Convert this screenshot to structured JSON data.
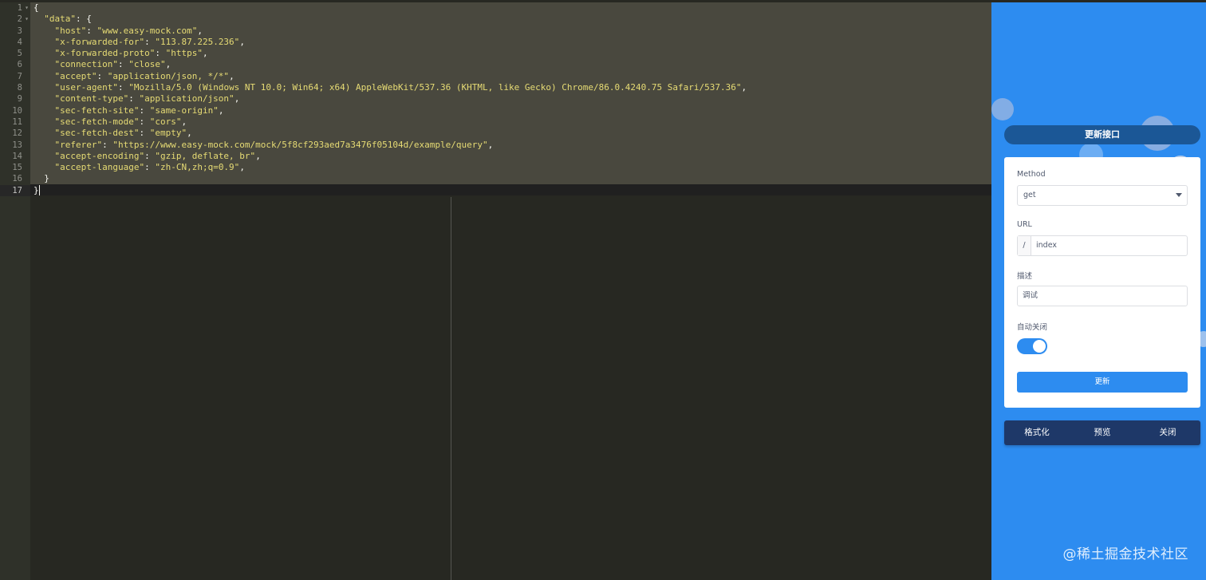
{
  "editor": {
    "line_numbers": [
      "1",
      "2",
      "3",
      "4",
      "5",
      "6",
      "7",
      "8",
      "9",
      "10",
      "11",
      "12",
      "13",
      "14",
      "15",
      "16",
      "17"
    ],
    "lines": [
      [
        {
          "t": "p",
          "v": "{"
        }
      ],
      [
        {
          "t": "p",
          "v": "  "
        },
        {
          "t": "key",
          "v": "\"data\""
        },
        {
          "t": "p",
          "v": ": {"
        }
      ],
      [
        {
          "t": "p",
          "v": "    "
        },
        {
          "t": "key",
          "v": "\"host\""
        },
        {
          "t": "p",
          "v": ": "
        },
        {
          "t": "str",
          "v": "\"www.easy-mock.com\""
        },
        {
          "t": "p",
          "v": ","
        }
      ],
      [
        {
          "t": "p",
          "v": "    "
        },
        {
          "t": "key",
          "v": "\"x-forwarded-for\""
        },
        {
          "t": "p",
          "v": ": "
        },
        {
          "t": "str",
          "v": "\"113.87.225.236\""
        },
        {
          "t": "p",
          "v": ","
        }
      ],
      [
        {
          "t": "p",
          "v": "    "
        },
        {
          "t": "key",
          "v": "\"x-forwarded-proto\""
        },
        {
          "t": "p",
          "v": ": "
        },
        {
          "t": "str",
          "v": "\"https\""
        },
        {
          "t": "p",
          "v": ","
        }
      ],
      [
        {
          "t": "p",
          "v": "    "
        },
        {
          "t": "key",
          "v": "\"connection\""
        },
        {
          "t": "p",
          "v": ": "
        },
        {
          "t": "str",
          "v": "\"close\""
        },
        {
          "t": "p",
          "v": ","
        }
      ],
      [
        {
          "t": "p",
          "v": "    "
        },
        {
          "t": "key",
          "v": "\"accept\""
        },
        {
          "t": "p",
          "v": ": "
        },
        {
          "t": "str",
          "v": "\"application/json, */*\""
        },
        {
          "t": "p",
          "v": ","
        }
      ],
      [
        {
          "t": "p",
          "v": "    "
        },
        {
          "t": "key",
          "v": "\"user-agent\""
        },
        {
          "t": "p",
          "v": ": "
        },
        {
          "t": "str",
          "v": "\"Mozilla/5.0 (Windows NT 10.0; Win64; x64) AppleWebKit/537.36 (KHTML, like Gecko) Chrome/86.0.4240.75 Safari/537.36\""
        },
        {
          "t": "p",
          "v": ","
        }
      ],
      [
        {
          "t": "p",
          "v": "    "
        },
        {
          "t": "key",
          "v": "\"content-type\""
        },
        {
          "t": "p",
          "v": ": "
        },
        {
          "t": "str",
          "v": "\"application/json\""
        },
        {
          "t": "p",
          "v": ","
        }
      ],
      [
        {
          "t": "p",
          "v": "    "
        },
        {
          "t": "key",
          "v": "\"sec-fetch-site\""
        },
        {
          "t": "p",
          "v": ": "
        },
        {
          "t": "str",
          "v": "\"same-origin\""
        },
        {
          "t": "p",
          "v": ","
        }
      ],
      [
        {
          "t": "p",
          "v": "    "
        },
        {
          "t": "key",
          "v": "\"sec-fetch-mode\""
        },
        {
          "t": "p",
          "v": ": "
        },
        {
          "t": "str",
          "v": "\"cors\""
        },
        {
          "t": "p",
          "v": ","
        }
      ],
      [
        {
          "t": "p",
          "v": "    "
        },
        {
          "t": "key",
          "v": "\"sec-fetch-dest\""
        },
        {
          "t": "p",
          "v": ": "
        },
        {
          "t": "str",
          "v": "\"empty\""
        },
        {
          "t": "p",
          "v": ","
        }
      ],
      [
        {
          "t": "p",
          "v": "    "
        },
        {
          "t": "key",
          "v": "\"referer\""
        },
        {
          "t": "p",
          "v": ": "
        },
        {
          "t": "str",
          "v": "\"https://www.easy-mock.com/mock/5f8cf293aed7a3476f05104d/example/query\""
        },
        {
          "t": "p",
          "v": ","
        }
      ],
      [
        {
          "t": "p",
          "v": "    "
        },
        {
          "t": "key",
          "v": "\"accept-encoding\""
        },
        {
          "t": "p",
          "v": ": "
        },
        {
          "t": "str",
          "v": "\"gzip, deflate, br\""
        },
        {
          "t": "p",
          "v": ","
        }
      ],
      [
        {
          "t": "p",
          "v": "    "
        },
        {
          "t": "key",
          "v": "\"accept-language\""
        },
        {
          "t": "p",
          "v": ": "
        },
        {
          "t": "str",
          "v": "\"zh-CN,zh;q=0.9\""
        },
        {
          "t": "p",
          "v": ","
        }
      ],
      [
        {
          "t": "p",
          "v": "  }"
        }
      ],
      [
        {
          "t": "p",
          "v": "}"
        }
      ]
    ],
    "fold_lines": [
      0,
      1
    ],
    "active_line": 16
  },
  "panel": {
    "title": "更新接口",
    "method": {
      "label": "Method",
      "value": "get"
    },
    "url": {
      "label": "URL",
      "prefix": "/",
      "value": "index"
    },
    "description": {
      "label": "描述",
      "value": "调试"
    },
    "auto_close": {
      "label": "自动关闭",
      "on": true
    },
    "submit_label": "更新",
    "actions": {
      "format": "格式化",
      "preview": "预览",
      "close": "关闭"
    }
  },
  "watermark": "@稀土掘金技术社区",
  "colors": {
    "editor_bg": "#272822",
    "selection": "#49483e",
    "string": "#e6db74",
    "panel_bg": "#2d8cf0",
    "title_bar": "#1b5796",
    "action_bar": "#1e3868"
  }
}
